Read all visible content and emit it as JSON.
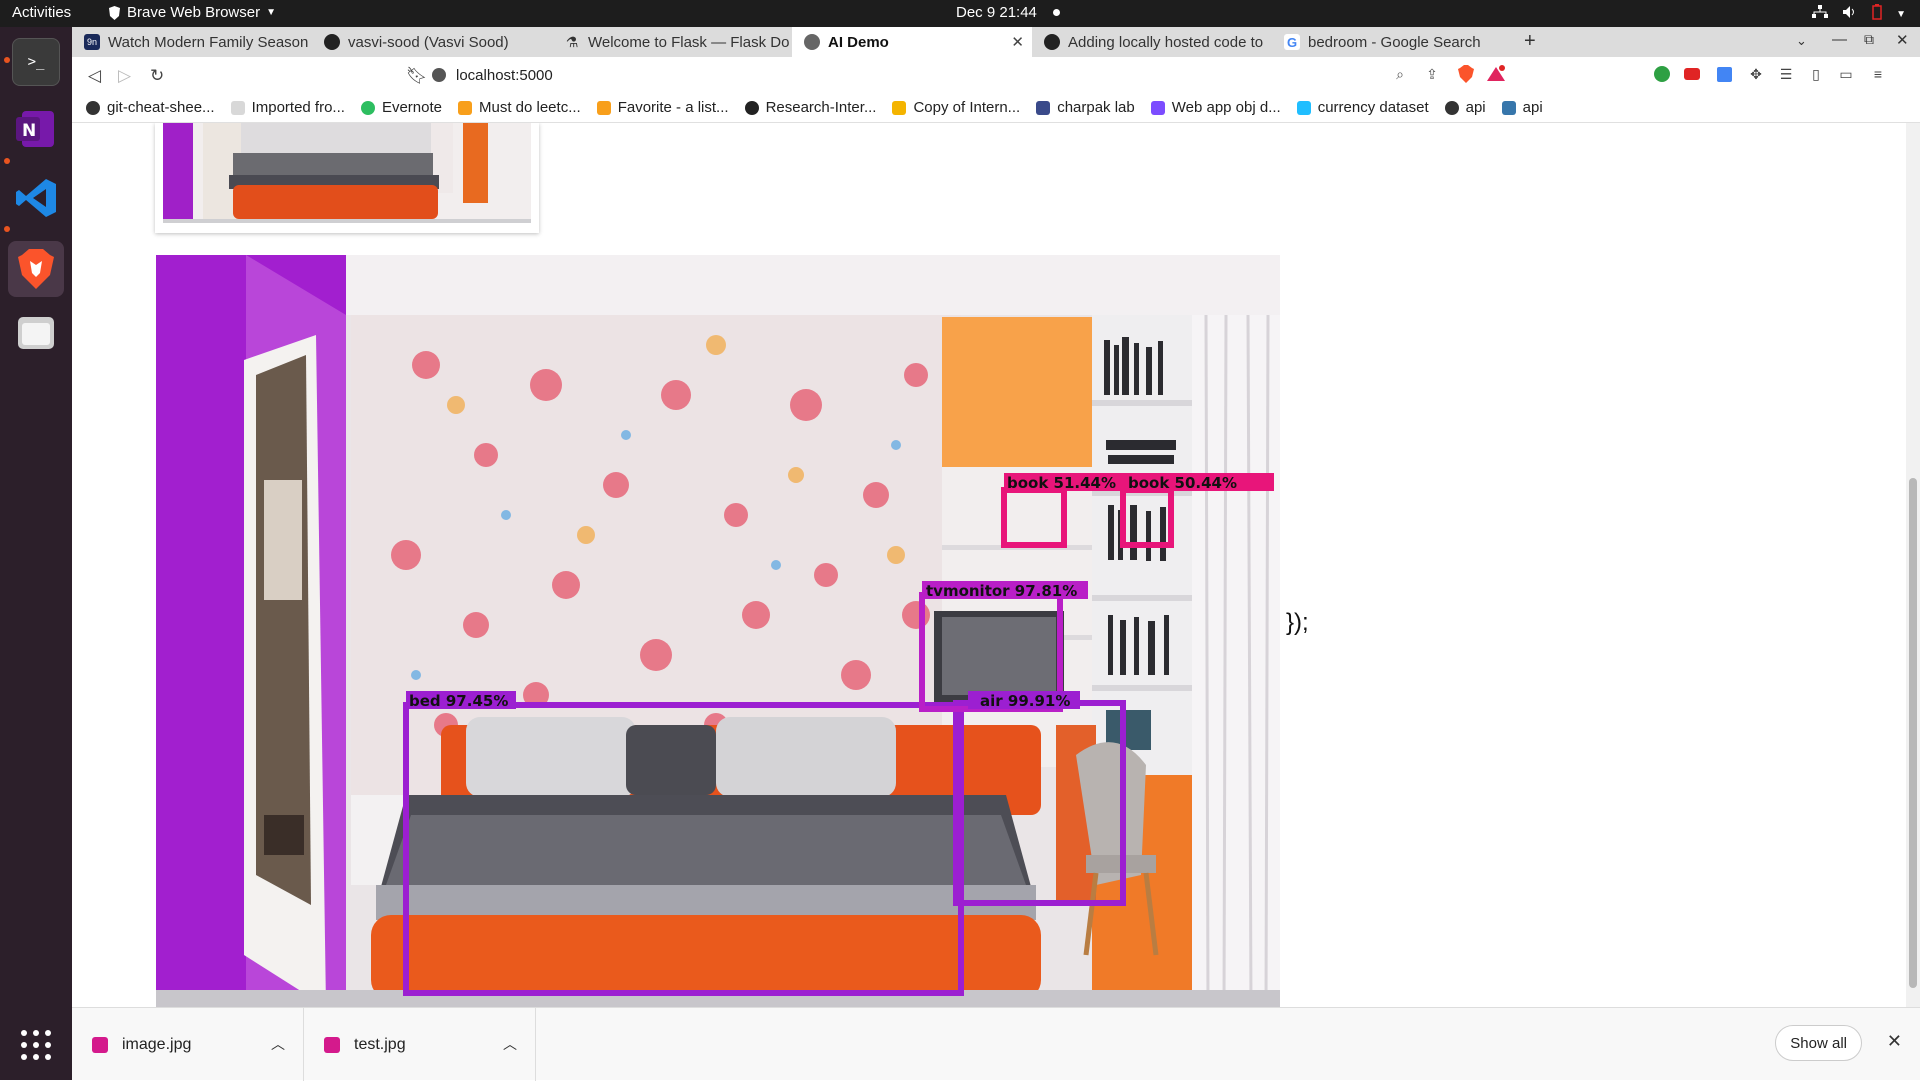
{
  "topbar": {
    "activities": "Activities",
    "app_name": "Brave Web Browser",
    "clock": "Dec 9  21:44"
  },
  "tabs": [
    {
      "label": "Watch Modern Family Season",
      "active": false
    },
    {
      "label": "vasvi-sood (Vasvi Sood)",
      "active": false
    },
    {
      "label": "Welcome to Flask — Flask Do",
      "active": false
    },
    {
      "label": "AI Demo",
      "active": true
    },
    {
      "label": "Adding locally hosted code to",
      "active": false
    },
    {
      "label": "bedroom - Google Search",
      "active": false
    }
  ],
  "url": "localhost:5000",
  "bookmarks": [
    "git-cheat-shee...",
    "Imported fro...",
    "Evernote",
    "Must do leetc...",
    "Favorite - a list...",
    "Research-Inter...",
    "Copy of Intern...",
    "charpak lab",
    "Web app obj d...",
    "currency dataset",
    "api",
    "api"
  ],
  "page": {
    "trailing_text": "});",
    "detections": [
      {
        "label": "book 51.44%"
      },
      {
        "label": "book 50.44%"
      },
      {
        "label": "tvmonitor 97.81%"
      },
      {
        "label": "bed 97.45%"
      },
      {
        "label": "air 99.91%"
      }
    ]
  },
  "downloads": {
    "items": [
      "image.jpg",
      "test.jpg"
    ],
    "show_all": "Show all"
  },
  "colors": {
    "accent_purple": "#9c1fd1",
    "accent_pink": "#e8157a",
    "accent_orange": "#e85a1a"
  }
}
